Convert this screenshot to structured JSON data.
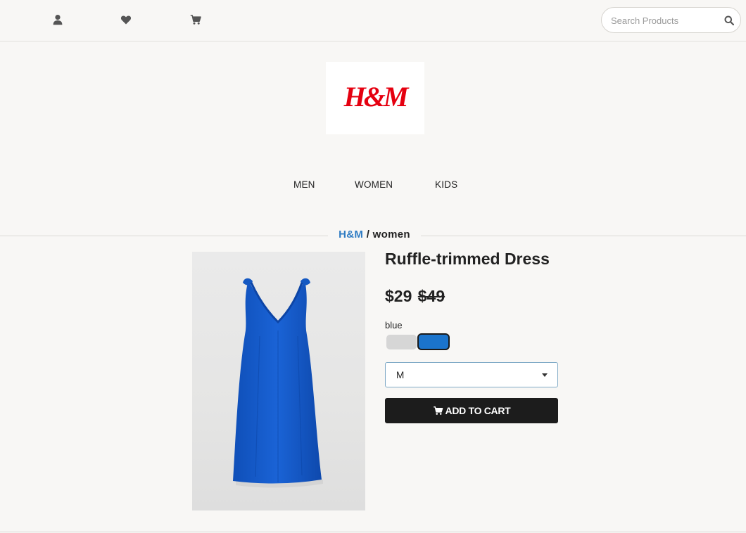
{
  "header": {
    "icons": [
      "user-icon",
      "heart-icon",
      "cart-icon"
    ],
    "search": {
      "placeholder": "Search Products",
      "value": "",
      "icon": "search-icon"
    }
  },
  "logo": {
    "text": "H&M",
    "color": "#e50010"
  },
  "nav": {
    "items": [
      "MEN",
      "WOMEN",
      "KIDS"
    ]
  },
  "breadcrumb": {
    "brand": "H&M",
    "separator": "/",
    "category": "women"
  },
  "product": {
    "title": "Ruffle-trimmed Dress",
    "price": "$29",
    "original_price": "$49",
    "color_label": "blue",
    "colors": [
      {
        "name": "grey",
        "hex": "#d6d6d6",
        "selected": false
      },
      {
        "name": "blue",
        "hex": "#1b74cc",
        "selected": true
      }
    ],
    "size": {
      "selected": "M"
    },
    "add_to_cart": {
      "label": "ADD TO CART",
      "icon": "cart-icon"
    }
  },
  "colors": {
    "accent_link": "#2f7cc3",
    "button_bg": "#1c1c1c",
    "page_bg": "#f8f7f5"
  }
}
